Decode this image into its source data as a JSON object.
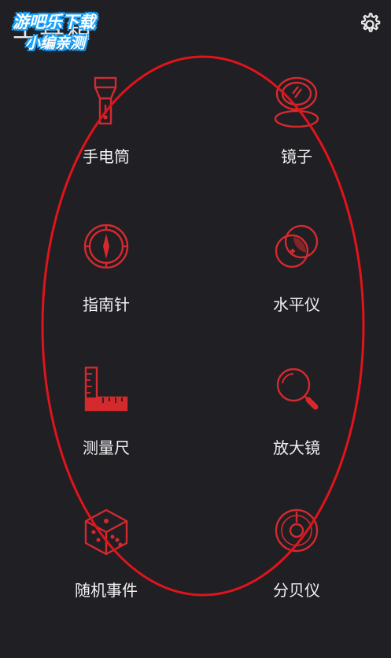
{
  "header": {
    "title": "工具箱",
    "settings_icon": "gear-icon"
  },
  "watermark": {
    "line1": "游吧乐下载",
    "line2": "小编亲测"
  },
  "tools": [
    {
      "label": "手电筒",
      "icon": "flashlight-icon"
    },
    {
      "label": "镜子",
      "icon": "mirror-icon"
    },
    {
      "label": "指南针",
      "icon": "compass-icon"
    },
    {
      "label": "水平仪",
      "icon": "level-icon"
    },
    {
      "label": "测量尺",
      "icon": "ruler-icon"
    },
    {
      "label": "放大镜",
      "icon": "magnifier-icon"
    },
    {
      "label": "随机事件",
      "icon": "dice-icon"
    },
    {
      "label": "分贝仪",
      "icon": "decibel-icon"
    }
  ],
  "colors": {
    "background": "#1f1f24",
    "icon_red": "#d42a2e",
    "annotation_red": "#e0141b",
    "watermark_blue": "#1aa4ff"
  }
}
